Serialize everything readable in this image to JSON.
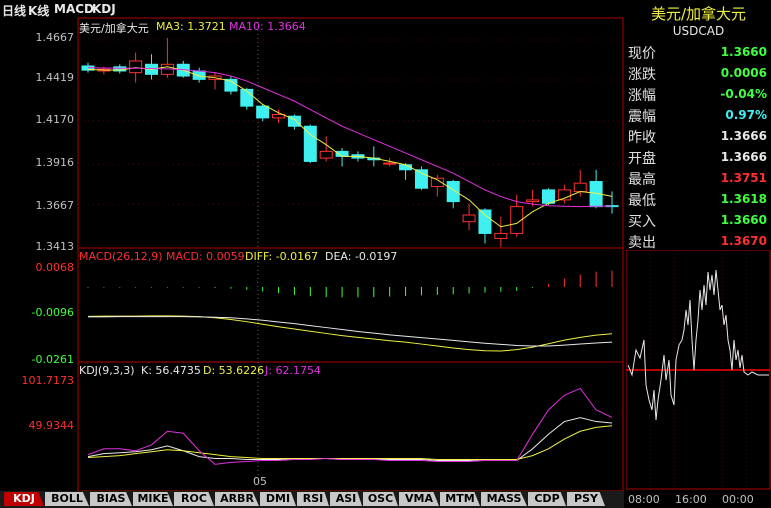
{
  "toolbar": {
    "title": "日线",
    "kline": "K线",
    "macd": "MACD",
    "kdj": "KDJ"
  },
  "colors": {
    "up": "#ff3030",
    "down": "#40f0f0",
    "ma3": "#f0f040",
    "ma10": "#e030e0",
    "diff": "#f0f040",
    "dea": "#e8e8e8",
    "k": "#e8e8e8",
    "d": "#f0f040",
    "j": "#e030e0"
  },
  "kline_header": {
    "name": "美元/加拿大元",
    "ma3": "MA3: 1.3721",
    "ma10": "MA10: 1.3664"
  },
  "kline_axis": [
    "1.4667",
    "1.4419",
    "1.4170",
    "1.3916",
    "1.3667",
    "1.3413"
  ],
  "macd_header": {
    "params": "MACD(26,12,9)",
    "macd": "MACD: 0.0059",
    "diff": "DIFF: -0.0167",
    "dea": "DEA: -0.0197"
  },
  "macd_axis": [
    "0.0068",
    "-0.0096",
    "-0.0261"
  ],
  "kdj_header": {
    "params": "KDJ(9,3,3)",
    "k": "K: 56.4735",
    "d": "D: 53.6226",
    "j": "J: 62.1754"
  },
  "kdj_axis": [
    "101.7173",
    "49.9344"
  ],
  "date_marker": "05",
  "tabs": [
    "KDJ",
    "BOLL",
    "BIAS",
    "MIKE",
    "ROC",
    "ARBR",
    "DMI",
    "RSI",
    "ASI",
    "OSC",
    "VMA",
    "MTM",
    "MASS",
    "CDP",
    "PSY"
  ],
  "panel": {
    "title": "美元/加拿大元",
    "code": "USDCAD",
    "rows": [
      {
        "k": "现价",
        "v": "1.3660",
        "c": "#40ff40"
      },
      {
        "k": "涨跌",
        "v": "0.0006",
        "c": "#40ff40"
      },
      {
        "k": "涨幅",
        "v": "-0.04%",
        "c": "#40ff40"
      },
      {
        "k": "震幅",
        "v": "0.97%",
        "c": "#40f0f0"
      },
      {
        "k": "昨收",
        "v": "1.3666",
        "c": "#e8e8e8"
      },
      {
        "k": "开盘",
        "v": "1.3666",
        "c": "#e8e8e8"
      },
      {
        "k": "最高",
        "v": "1.3751",
        "c": "#ff3030"
      },
      {
        "k": "最低",
        "v": "1.3618",
        "c": "#40ff40"
      },
      {
        "k": "买入",
        "v": "1.3660",
        "c": "#40ff40"
      },
      {
        "k": "卖出",
        "v": "1.3670",
        "c": "#ff3030"
      }
    ]
  },
  "intraday_times": [
    "08:00",
    "16:00",
    "00:00"
  ],
  "chart_data": {
    "type": "candlestick",
    "price_range": [
      1.3413,
      1.4667
    ],
    "candles": [
      {
        "o": 1.45,
        "c": 1.4475,
        "h": 1.452,
        "l": 1.446
      },
      {
        "o": 1.447,
        "c": 1.448,
        "h": 1.4495,
        "l": 1.445
      },
      {
        "o": 1.4495,
        "c": 1.447,
        "h": 1.451,
        "l": 1.4455
      },
      {
        "o": 1.446,
        "c": 1.453,
        "h": 1.458,
        "l": 1.44
      },
      {
        "o": 1.451,
        "c": 1.445,
        "h": 1.457,
        "l": 1.442
      },
      {
        "o": 1.445,
        "c": 1.451,
        "h": 1.4667,
        "l": 1.443
      },
      {
        "o": 1.451,
        "c": 1.444,
        "h": 1.453,
        "l": 1.443
      },
      {
        "o": 1.447,
        "c": 1.442,
        "h": 1.449,
        "l": 1.44
      },
      {
        "o": 1.442,
        "c": 1.444,
        "h": 1.446,
        "l": 1.436
      },
      {
        "o": 1.442,
        "c": 1.435,
        "h": 1.444,
        "l": 1.433
      },
      {
        "o": 1.436,
        "c": 1.426,
        "h": 1.437,
        "l": 1.424
      },
      {
        "o": 1.426,
        "c": 1.419,
        "h": 1.427,
        "l": 1.417
      },
      {
        "o": 1.419,
        "c": 1.421,
        "h": 1.424,
        "l": 1.416
      },
      {
        "o": 1.42,
        "c": 1.414,
        "h": 1.421,
        "l": 1.412
      },
      {
        "o": 1.414,
        "c": 1.393,
        "h": 1.415,
        "l": 1.392
      },
      {
        "o": 1.395,
        "c": 1.399,
        "h": 1.408,
        "l": 1.393
      },
      {
        "o": 1.399,
        "c": 1.396,
        "h": 1.401,
        "l": 1.39
      },
      {
        "o": 1.397,
        "c": 1.395,
        "h": 1.399,
        "l": 1.393
      },
      {
        "o": 1.395,
        "c": 1.394,
        "h": 1.402,
        "l": 1.39
      },
      {
        "o": 1.392,
        "c": 1.392,
        "h": 1.395,
        "l": 1.39
      },
      {
        "o": 1.391,
        "c": 1.388,
        "h": 1.392,
        "l": 1.382
      },
      {
        "o": 1.388,
        "c": 1.377,
        "h": 1.39,
        "l": 1.376
      },
      {
        "o": 1.378,
        "c": 1.383,
        "h": 1.385,
        "l": 1.372
      },
      {
        "o": 1.381,
        "c": 1.369,
        "h": 1.382,
        "l": 1.365
      },
      {
        "o": 1.357,
        "c": 1.361,
        "h": 1.368,
        "l": 1.352
      },
      {
        "o": 1.364,
        "c": 1.35,
        "h": 1.365,
        "l": 1.344
      },
      {
        "o": 1.347,
        "c": 1.35,
        "h": 1.36,
        "l": 1.342
      },
      {
        "o": 1.35,
        "c": 1.366,
        "h": 1.373,
        "l": 1.348
      },
      {
        "o": 1.369,
        "c": 1.37,
        "h": 1.376,
        "l": 1.366
      },
      {
        "o": 1.376,
        "c": 1.368,
        "h": 1.377,
        "l": 1.367
      },
      {
        "o": 1.37,
        "c": 1.376,
        "h": 1.379,
        "l": 1.368
      },
      {
        "o": 1.375,
        "c": 1.38,
        "h": 1.388,
        "l": 1.372
      },
      {
        "o": 1.381,
        "c": 1.366,
        "h": 1.388,
        "l": 1.365
      },
      {
        "o": 1.3666,
        "c": 1.366,
        "h": 1.3751,
        "l": 1.3618
      }
    ],
    "ma3": [
      1.448,
      1.4476,
      1.4475,
      1.449,
      1.448,
      1.4495,
      1.4475,
      1.444,
      1.443,
      1.441,
      1.435,
      1.427,
      1.422,
      1.418,
      1.409,
      1.403,
      1.396,
      1.396,
      1.395,
      1.393,
      1.391,
      1.386,
      1.382,
      1.376,
      1.37,
      1.361,
      1.354,
      1.356,
      1.363,
      1.368,
      1.371,
      1.375,
      1.374,
      1.3721
    ],
    "ma10": [
      1.449,
      1.4488,
      1.4486,
      1.4487,
      1.4485,
      1.4483,
      1.4478,
      1.447,
      1.446,
      1.444,
      1.441,
      1.437,
      1.433,
      1.429,
      1.424,
      1.419,
      1.414,
      1.41,
      1.406,
      1.402,
      1.398,
      1.394,
      1.39,
      1.386,
      1.381,
      1.376,
      1.372,
      1.369,
      1.3675,
      1.3665,
      1.3662,
      1.366,
      1.3662,
      1.3664
    ],
    "macd_range": [
      -0.0261,
      0.0068
    ],
    "macd_hist": [
      -0.0002,
      -0.0002,
      -0.0002,
      -0.0002,
      -0.0002,
      -0.0002,
      -0.0002,
      -0.0002,
      -0.0003,
      -0.0006,
      -0.001,
      -0.0016,
      -0.0022,
      -0.0028,
      -0.0033,
      -0.0036,
      -0.0037,
      -0.0037,
      -0.0036,
      -0.0034,
      -0.0032,
      -0.003,
      -0.0028,
      -0.0026,
      -0.0023,
      -0.002,
      -0.0017,
      -0.0014,
      -0.0003,
      0.001,
      0.003,
      0.0045,
      0.0055,
      0.0059
    ],
    "diff": [
      -0.0105,
      -0.0104,
      -0.0104,
      -0.0104,
      -0.0103,
      -0.0103,
      -0.0104,
      -0.0106,
      -0.011,
      -0.0116,
      -0.0124,
      -0.0133,
      -0.0142,
      -0.015,
      -0.0158,
      -0.0166,
      -0.0174,
      -0.018,
      -0.0186,
      -0.0192,
      -0.0197,
      -0.0204,
      -0.0211,
      -0.0218,
      -0.0224,
      -0.0228,
      -0.0229,
      -0.0224,
      -0.0215,
      -0.0203,
      -0.019,
      -0.018,
      -0.0172,
      -0.0167
    ],
    "dea": [
      -0.0107,
      -0.0107,
      -0.0106,
      -0.0106,
      -0.0106,
      -0.0106,
      -0.0106,
      -0.0107,
      -0.0108,
      -0.011,
      -0.0114,
      -0.0119,
      -0.0125,
      -0.0131,
      -0.0138,
      -0.0145,
      -0.0152,
      -0.0159,
      -0.0165,
      -0.0171,
      -0.0176,
      -0.0181,
      -0.0186,
      -0.0191,
      -0.0196,
      -0.0201,
      -0.0205,
      -0.0209,
      -0.0211,
      -0.0211,
      -0.0208,
      -0.0204,
      -0.02,
      -0.0197
    ],
    "kdj_range": [
      0,
      101.7173
    ],
    "k": [
      22,
      25,
      26,
      27,
      29,
      33,
      28,
      22,
      20,
      20,
      19,
      19,
      19,
      20,
      20,
      20,
      19,
      19,
      19,
      19,
      19,
      19,
      18,
      18,
      18,
      19,
      18,
      18,
      30,
      45,
      58,
      62,
      58,
      56.4735
    ],
    "d": [
      21,
      22,
      23,
      25,
      27,
      29,
      28,
      26,
      24,
      22,
      21,
      20,
      20,
      20,
      20,
      20,
      20,
      20,
      20,
      20,
      20,
      20,
      19,
      19,
      19,
      19,
      19,
      19,
      23,
      30,
      40,
      48,
      52,
      53.6226
    ],
    "j": [
      24,
      30,
      30,
      28,
      34,
      48,
      46,
      28,
      14,
      16,
      17,
      18,
      18,
      19,
      19,
      20,
      19,
      19,
      19,
      18,
      18,
      18,
      17,
      17,
      17,
      18,
      18,
      18,
      45,
      70,
      85,
      92,
      70,
      62.1754
    ]
  }
}
